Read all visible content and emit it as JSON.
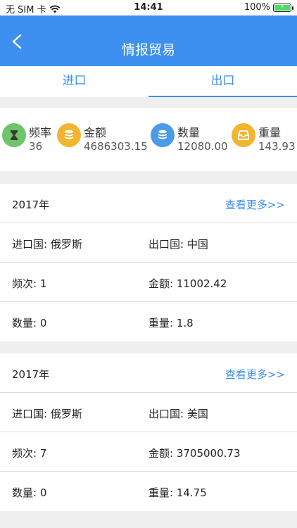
{
  "status": {
    "carrier": "无 SIM 卡",
    "time": "14:41",
    "battery": "100%"
  },
  "header": {
    "title": "情报贸易"
  },
  "tabs": [
    {
      "label": "进口"
    },
    {
      "label": "出口"
    }
  ],
  "stats": [
    {
      "label": "频率",
      "value": "36",
      "icon": "hourglass-icon",
      "color": "#6fc46a"
    },
    {
      "label": "金额",
      "value": "4686303.15",
      "icon": "coins-icon",
      "color": "#f2b531"
    },
    {
      "label": "数量",
      "value": "12080.00",
      "icon": "database-icon",
      "color": "#4a9be8"
    },
    {
      "label": "重量",
      "value": "143.93",
      "icon": "inbox-icon",
      "color": "#f2b531"
    }
  ],
  "records": [
    {
      "year": "2017年",
      "more": "查看更多>>",
      "importer": "进口国: 俄罗斯",
      "exporter": "出口国: 中国",
      "frequency": "频次: 1",
      "amount": "金额: 11002.42",
      "quantity": "数量: 0",
      "weight": "重量: 1.8"
    },
    {
      "year": "2017年",
      "more": "查看更多>>",
      "importer": "进口国: 俄罗斯",
      "exporter": "出口国: 美国",
      "frequency": "频次: 7",
      "amount": "金额: 3705000.73",
      "quantity": "数量: 0",
      "weight": "重量: 14.75"
    }
  ]
}
